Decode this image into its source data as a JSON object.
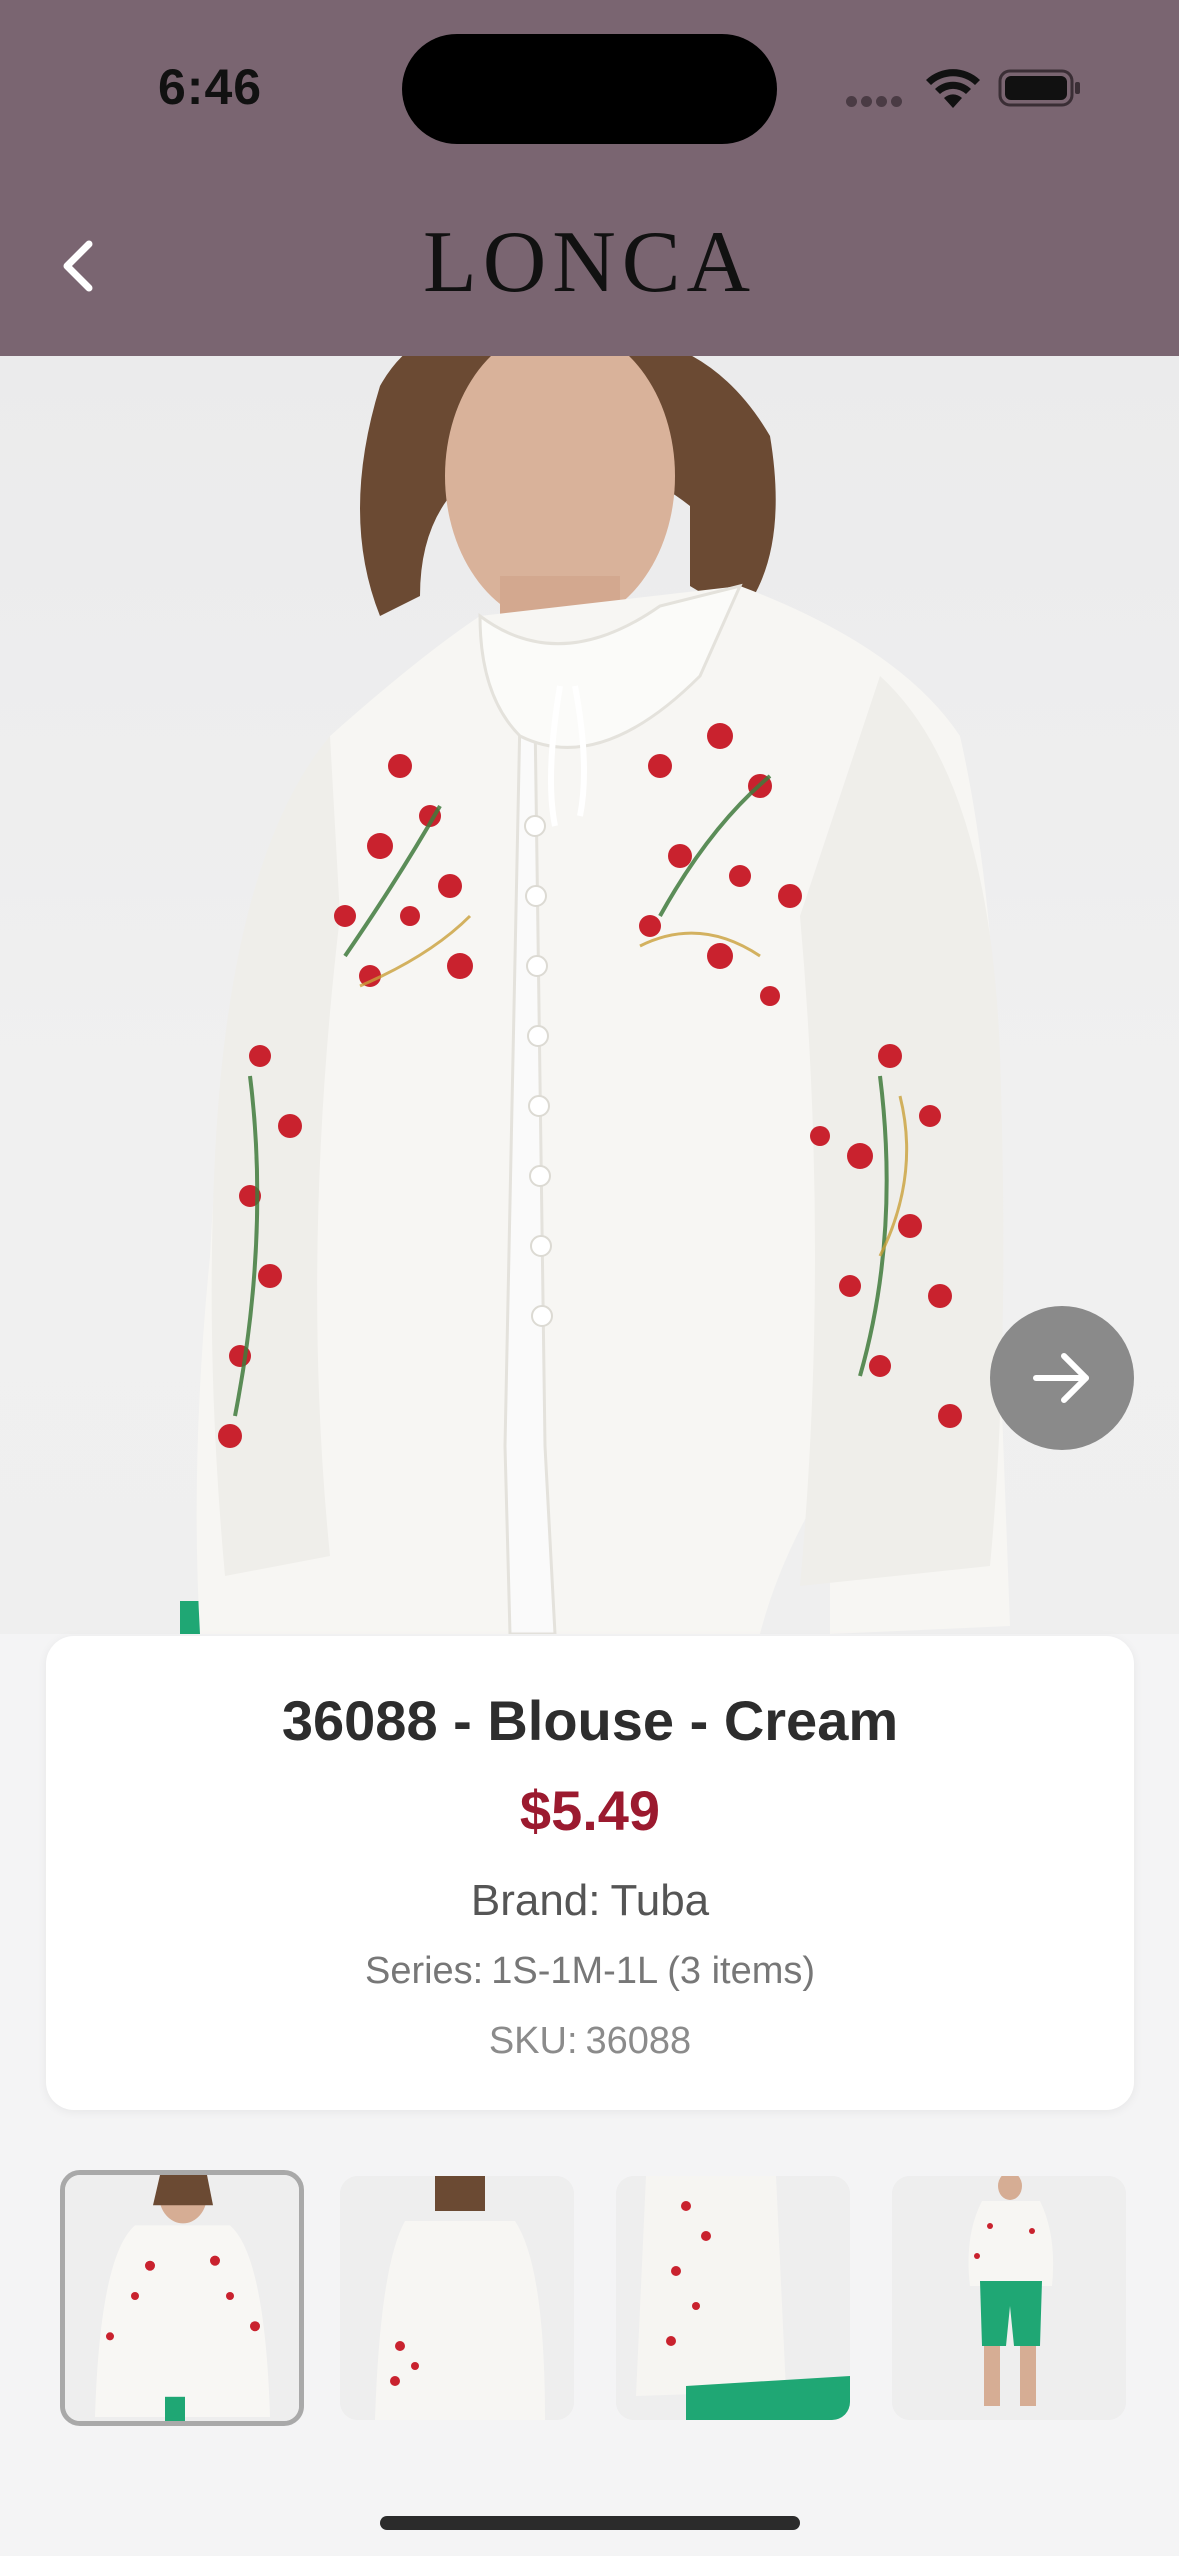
{
  "status_bar": {
    "time": "6:46",
    "icons": [
      "cellular-dots-icon",
      "wifi-icon",
      "battery-icon"
    ]
  },
  "header": {
    "logo": "LONCA",
    "back_icon": "chevron-left-icon",
    "background_color": "#7a6571"
  },
  "gallery": {
    "next_icon": "arrow-right-icon",
    "image_count": 4,
    "selected_index": 0
  },
  "product": {
    "title": "36088 - Blouse - Cream",
    "price": "$5.49",
    "brand_label": "Brand:",
    "brand_value": "Tuba",
    "series_label": "Series:",
    "series_value": "1S-1M-1L (3 items)",
    "sku_label": "SKU:",
    "sku_value": "36088",
    "price_color": "#9b1a2f"
  }
}
